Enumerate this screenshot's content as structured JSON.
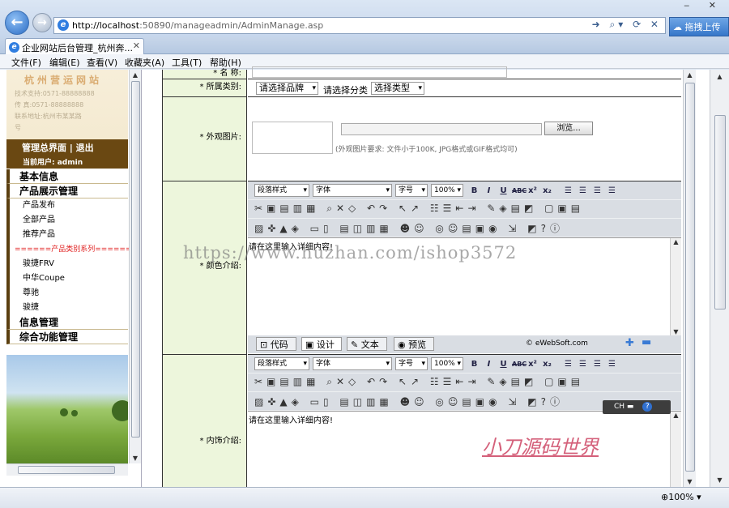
{
  "browser": {
    "url_host": "http://localhost",
    "url_path": ":50890/manageadmin/AdminManage.asp",
    "addon_label": "拖拽上传",
    "tab_title": "企业网站后台管理_杭州奔...",
    "zoom": "100%",
    "menu": [
      "文件(F)",
      "编辑(E)",
      "查看(V)",
      "收藏夹(A)",
      "工具(T)",
      "帮助(H)"
    ]
  },
  "sidebar": {
    "logo_title": "杭州营运网站",
    "logo_lines": [
      "技术支持:0571-88888888",
      "传    真:0571-88888888",
      "联系地址:杭州市某某路",
      "   号"
    ],
    "admin_links": "管理总界面 | 退出",
    "current_user": "当前用户: admin",
    "sections": [
      {
        "label": "基本信息"
      },
      {
        "label": "产品展示管理",
        "items": [
          "产品发布",
          "全部产品",
          "推荐产品",
          "======产品类别系列======",
          "骏捷FRV",
          "中华Coupe",
          "尊驰",
          "骏捷"
        ]
      },
      {
        "label": "信息管理"
      },
      {
        "label": "综合功能管理"
      }
    ]
  },
  "form": {
    "name_label": "* 名  称:",
    "category_label": "* 所属类别:",
    "brand_select": "请选择品牌",
    "class_select": "请选择分类",
    "type_select": "选择类型",
    "image_label": "* 外观图片:",
    "browse_button": "浏览...",
    "image_note": "(外观图片要求: 文件小于100K, JPG格式或GIF格式均可)",
    "color_label": "* 颜色介绍:",
    "interior_label": "* 内饰介绍:"
  },
  "editor": {
    "style_select": "段落样式",
    "font_select": "字体",
    "size_select": "字号",
    "zoom_select": "100%",
    "placeholder": "请在这里输入详细内容!",
    "modes": [
      "代码",
      "设计",
      "文本",
      "预览"
    ],
    "brand": "eWebSoft.com"
  },
  "overlays": {
    "watermark": "https://www.huzhan.com/ishop3572",
    "stamp": "小刀源码世界",
    "ime": "CH"
  }
}
